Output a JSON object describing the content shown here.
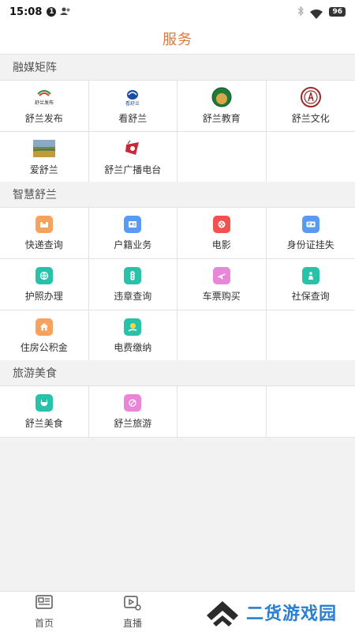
{
  "status_bar": {
    "time": "15:08",
    "notification_badge": "1",
    "battery": "96"
  },
  "header": {
    "title": "服务"
  },
  "sections": [
    {
      "title": "融媒矩阵",
      "items": [
        {
          "label": "舒兰发布",
          "icon": "shulan-release-logo",
          "logo_text": "舒兰发布"
        },
        {
          "label": "看舒兰",
          "icon": "kan-shulan-logo",
          "logo_text": "看舒兰"
        },
        {
          "label": "舒兰教育",
          "icon": "shulan-education-logo"
        },
        {
          "label": "舒兰文化",
          "icon": "shulan-culture-logo"
        },
        {
          "label": "爱舒兰",
          "icon": "landscape-photo-icon"
        },
        {
          "label": "舒兰广播电台",
          "icon": "radio-station-logo"
        }
      ]
    },
    {
      "title": "智慧舒兰",
      "items": [
        {
          "label": "快递查询",
          "icon": "express-icon",
          "color": "#f5a25d"
        },
        {
          "label": "户籍业务",
          "icon": "household-icon",
          "color": "#5a9bf2"
        },
        {
          "label": "电影",
          "icon": "movie-icon",
          "color": "#f0524f"
        },
        {
          "label": "身份证挂失",
          "icon": "id-card-icon",
          "color": "#5a9bf2"
        },
        {
          "label": "护照办理",
          "icon": "passport-icon",
          "color": "#27c2a8"
        },
        {
          "label": "违章查询",
          "icon": "traffic-icon",
          "color": "#27c2a8"
        },
        {
          "label": "车票购买",
          "icon": "ticket-icon",
          "color": "#e986d8"
        },
        {
          "label": "社保查询",
          "icon": "social-security-icon",
          "color": "#27c2a8"
        },
        {
          "label": "住房公积金",
          "icon": "housing-fund-icon",
          "color": "#f5a25d"
        },
        {
          "label": "电费缴纳",
          "icon": "electricity-icon",
          "color": "#27c2a8"
        }
      ]
    },
    {
      "title": "旅游美食",
      "items": [
        {
          "label": "舒兰美食",
          "icon": "food-icon",
          "color": "#27c2a8"
        },
        {
          "label": "舒兰旅游",
          "icon": "travel-icon",
          "color": "#e986d8"
        }
      ]
    }
  ],
  "tabbar": [
    {
      "label": "首页",
      "icon": "news-icon"
    },
    {
      "label": "直播",
      "icon": "live-video-icon"
    }
  ],
  "watermark": {
    "text": "二货游戏园"
  },
  "colors": {
    "accent": "#e0783c",
    "watermark": "#2a7fd1"
  }
}
